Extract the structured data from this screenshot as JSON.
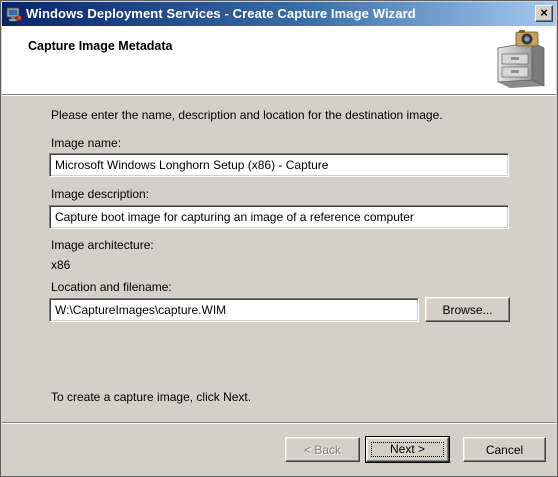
{
  "window": {
    "title": "Windows Deployment Services - Create Capture Image Wizard",
    "close_label": "×"
  },
  "header": {
    "title": "Capture Image Metadata"
  },
  "body": {
    "intro": "Please enter the name, description and location for the destination image.",
    "image_name_label": "Image name:",
    "image_name_value": "Microsoft Windows Longhorn Setup (x86) - Capture",
    "image_description_label": "Image description:",
    "image_description_value": "Capture boot image for capturing an image of a reference computer",
    "architecture_label": "Image architecture:",
    "architecture_value": "x86",
    "location_label": "Location and filename:",
    "location_value": "W:\\CaptureImages\\capture.WIM",
    "browse_label": "Browse...",
    "footer_note": "To create a capture image, click Next."
  },
  "buttons": {
    "back_label": "< Back",
    "next_label": "Next >",
    "cancel_label": "Cancel"
  },
  "colors": {
    "titlebar_start": "#0a246a",
    "titlebar_end": "#a6caf0",
    "dialog_face": "#d4d0c8"
  }
}
